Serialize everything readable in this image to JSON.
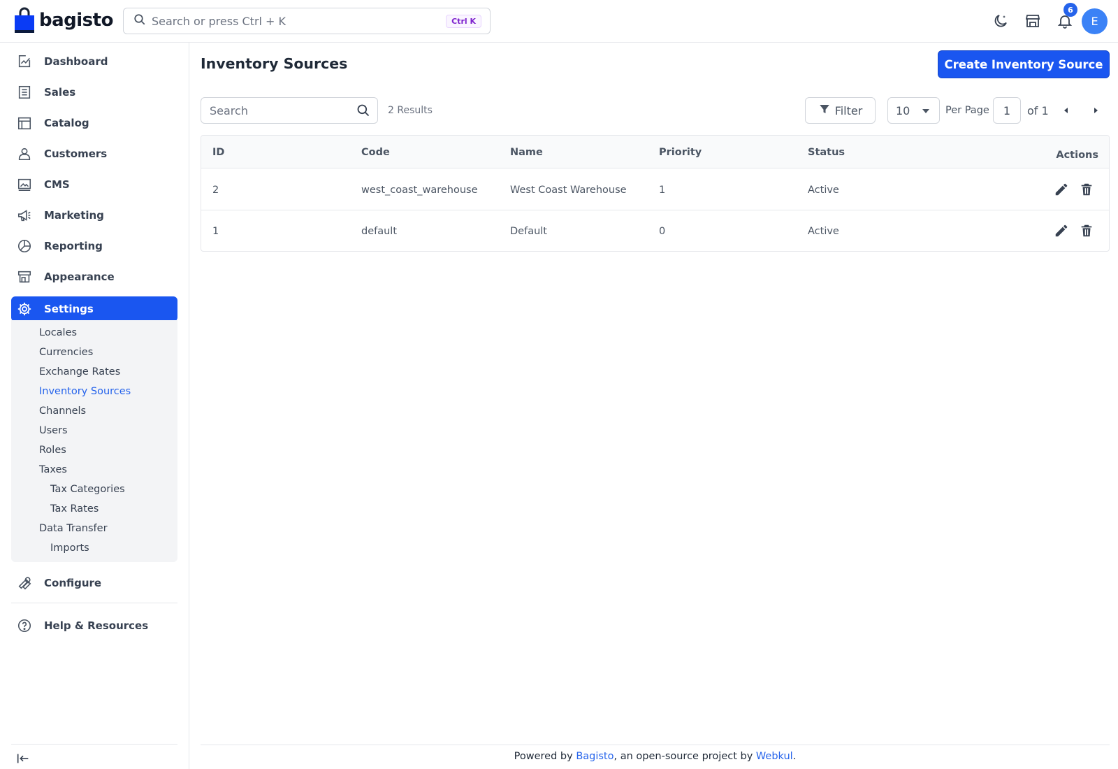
{
  "header": {
    "logo_text": "bagisto",
    "search_placeholder": "Search or press Ctrl + K",
    "search_shortcut": "Ctrl K",
    "notification_count": "6",
    "avatar_initial": "E",
    "icons": [
      "moon-icon",
      "store-icon",
      "bell-icon"
    ]
  },
  "sidebar": {
    "items": [
      {
        "label": "Dashboard",
        "icon": "dashboard-icon"
      },
      {
        "label": "Sales",
        "icon": "sales-icon"
      },
      {
        "label": "Catalog",
        "icon": "catalog-icon"
      },
      {
        "label": "Customers",
        "icon": "customers-icon"
      },
      {
        "label": "CMS",
        "icon": "cms-icon"
      },
      {
        "label": "Marketing",
        "icon": "megaphone-icon"
      },
      {
        "label": "Reporting",
        "icon": "pie-chart-icon"
      },
      {
        "label": "Appearance",
        "icon": "storefront-icon"
      },
      {
        "label": "Settings",
        "icon": "gear-icon"
      },
      {
        "label": "Configure",
        "icon": "wrench-icon"
      },
      {
        "label": "Help & Resources",
        "icon": "help-icon"
      }
    ],
    "settings_submenu": [
      "Locales",
      "Currencies",
      "Exchange Rates",
      "Inventory Sources",
      "Channels",
      "Users",
      "Roles",
      "Taxes",
      "Tax Categories",
      "Tax Rates",
      "Data Transfer",
      "Imports"
    ],
    "active_item": "Settings",
    "active_subitem": "Inventory Sources"
  },
  "main": {
    "title": "Inventory Sources",
    "create_button": "Create Inventory Source",
    "search_placeholder": "Search",
    "results_text": "2 Results",
    "filter_label": "Filter",
    "per_page_value": "10",
    "per_page_label": "Per Page",
    "current_page": "1",
    "page_of": "of 1",
    "columns": [
      "ID",
      "Code",
      "Name",
      "Priority",
      "Status",
      "Actions"
    ],
    "rows": [
      {
        "id": "2",
        "code": "west_coast_warehouse",
        "name": "West Coast Warehouse",
        "priority": "1",
        "status": "Active"
      },
      {
        "id": "1",
        "code": "default",
        "name": "Default",
        "priority": "0",
        "status": "Active"
      }
    ]
  },
  "footer": {
    "prefix": "Powered by ",
    "link1": "Bagisto",
    "middle": ", an open-source project by ",
    "link2": "Webkul",
    "suffix": "."
  },
  "colors": {
    "primary": "#1a56f0",
    "link": "#2563eb",
    "kbd_text": "#7e22ce"
  }
}
